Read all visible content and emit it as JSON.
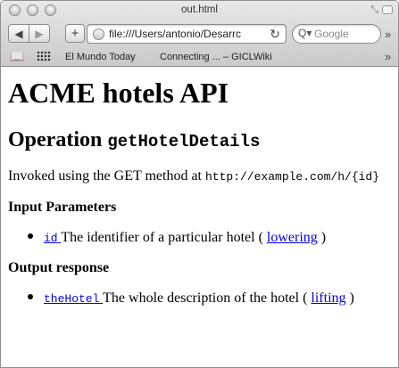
{
  "window": {
    "title": "out.html"
  },
  "navbar": {
    "back_glyph": "◀",
    "forward_glyph": "▶",
    "add_glyph": "+",
    "url": "file:///Users/antonio/Desarrc",
    "reload_glyph": "↻",
    "search_placeholder": "Google",
    "search_glyph": "Q▾",
    "overflow_glyph": "»"
  },
  "bookmarks": {
    "book_glyph": "📖",
    "items": [
      "El Mundo Today",
      "Connecting ... – GICLWiki"
    ],
    "overflow_glyph": "»"
  },
  "page": {
    "title": "ACME hotels API",
    "operation_label": "Operation",
    "operation_name": "getHotelDetails",
    "invoked_text": "Invoked using the GET method at",
    "invoked_url": "http://example.com/h/{id}",
    "input_heading": "Input Parameters",
    "input_param": {
      "name": "id",
      "description": "The identifier of a particular hotel (",
      "link": "lowering",
      "close": ")"
    },
    "output_heading": "Output response",
    "output_param": {
      "name": "theHotel",
      "description": "The whole description of the hotel (",
      "link": "lifting",
      "close": ")"
    }
  },
  "icons": {
    "window_controls": [
      "close-icon",
      "minimize-icon",
      "zoom-icon"
    ],
    "globe": "globe-icon",
    "reload": "reload-icon",
    "search": "magnifier-icon",
    "bookmarks": "book-icon",
    "top_sites": "grid-icon"
  }
}
